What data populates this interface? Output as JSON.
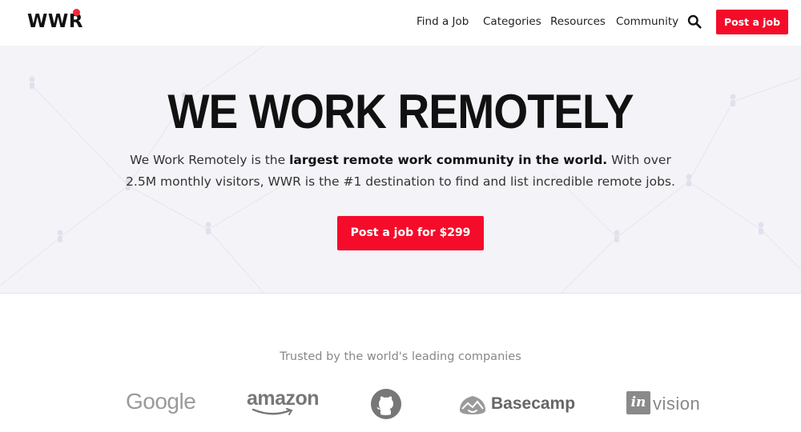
{
  "header": {
    "logo": "WWR",
    "nav": [
      "Find a Job",
      "Categories",
      "Resources",
      "Community"
    ],
    "post_button": "Post a job",
    "brand_color": "#f40c2a"
  },
  "hero": {
    "title": "WE WORK REMOTELY",
    "desc_intro": "We Work Remotely is the ",
    "desc_bold": "largest remote work community in the world.",
    "desc_rest": " With over 2.5M monthly visitors, WWR is the #1 destination to find and list incredible remote jobs.",
    "cta": "Post a job for $299"
  },
  "trusted": {
    "heading": "Trusted by the world's leading companies",
    "companies": [
      "Google",
      "amazon",
      "GitHub",
      "Basecamp",
      "invision"
    ],
    "google_label": "Google",
    "amazon_label": "amazon",
    "basecamp_label": "Basecamp",
    "invision_mark": "in",
    "invision_label": "vision"
  },
  "icons": {
    "search": "search-icon",
    "github": "github-icon",
    "basecamp": "basecamp-icon"
  }
}
